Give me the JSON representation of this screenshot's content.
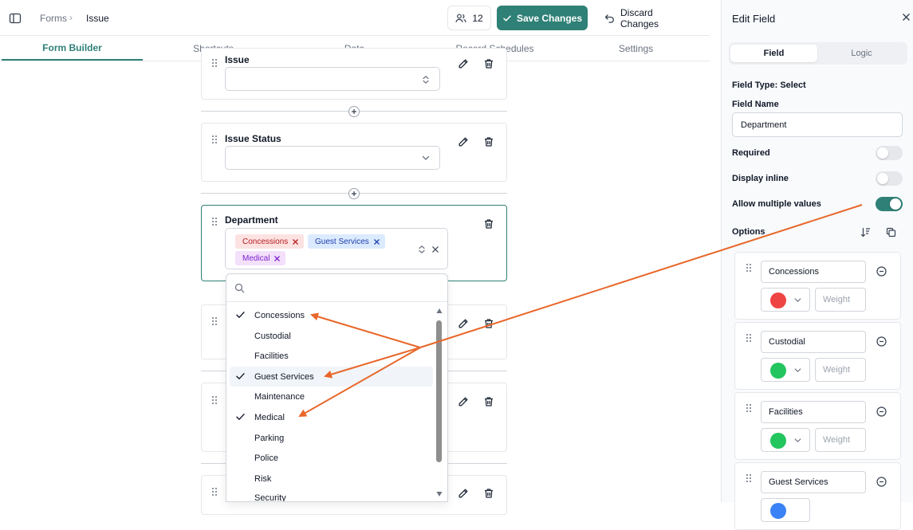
{
  "breadcrumb": {
    "root": "Forms",
    "separator": "›",
    "current": "Issue"
  },
  "header": {
    "users_count": "12",
    "save_label": "Save Changes",
    "discard_label": "Discard Changes"
  },
  "tabs": [
    {
      "label": "Form Builder",
      "active": true
    },
    {
      "label": "Shortcuts",
      "active": false
    },
    {
      "label": "Data",
      "active": false
    },
    {
      "label": "Record Schedules",
      "active": false
    },
    {
      "label": "Settings",
      "active": false
    }
  ],
  "fields": {
    "issue": {
      "label": "Issue"
    },
    "issue_status": {
      "label": "Issue Status"
    },
    "department": {
      "label": "Department",
      "selected": [
        {
          "label": "Concessions",
          "color": "#fde2e2"
        },
        {
          "label": "Guest Services",
          "color": "#dbeafe"
        },
        {
          "label": "Medical",
          "color": "#f3e0fb"
        }
      ]
    }
  },
  "dropdown": {
    "search_placeholder": "",
    "options": [
      {
        "label": "Concessions",
        "checked": true
      },
      {
        "label": "Custodial",
        "checked": false
      },
      {
        "label": "Facilities",
        "checked": false
      },
      {
        "label": "Guest Services",
        "checked": true,
        "highlighted": true
      },
      {
        "label": "Maintenance",
        "checked": false
      },
      {
        "label": "Medical",
        "checked": true
      },
      {
        "label": "Parking",
        "checked": false
      },
      {
        "label": "Police",
        "checked": false
      },
      {
        "label": "Risk",
        "checked": false
      },
      {
        "label": "Security",
        "checked": false
      }
    ]
  },
  "panel": {
    "title": "Edit Field",
    "tabs": {
      "field": "Field",
      "logic": "Logic"
    },
    "field_type_label": "Field Type:",
    "field_type_value": "Select",
    "field_name_label": "Field Name",
    "field_name_value": "Department",
    "required_label": "Required",
    "required_on": false,
    "display_inline_label": "Display inline",
    "display_inline_on": false,
    "allow_multiple_label": "Allow multiple values",
    "allow_multiple_on": true,
    "options_label": "Options",
    "weight_placeholder": "Weight",
    "options": [
      {
        "name": "Concessions",
        "color": "#ef4444"
      },
      {
        "name": "Custodial",
        "color": "#22c55e"
      },
      {
        "name": "Facilities",
        "color": "#22c55e"
      },
      {
        "name": "Guest Services",
        "color": "#3b82f6"
      }
    ]
  },
  "colors": {
    "accent": "#2f8076",
    "annotation_arrow": "#e8672a"
  }
}
